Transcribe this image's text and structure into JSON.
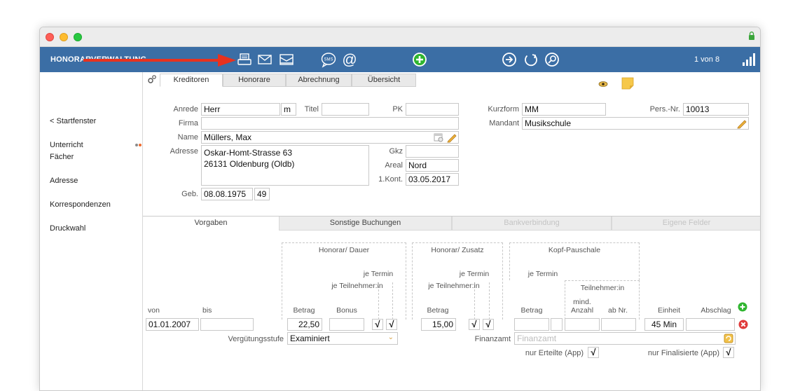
{
  "app": {
    "title": "HONORARVERWALTUNG",
    "record_counter": "1 von 8"
  },
  "toolbar": {
    "icons": [
      "printer-icon",
      "envelope-icon",
      "letter-icon",
      "sms-icon",
      "at-icon",
      "add-icon",
      "forward-icon",
      "refresh-icon",
      "search-icon",
      "signal-icon"
    ]
  },
  "sidebar": {
    "items": [
      {
        "label": "< Startfenster"
      },
      {
        "label": "Unterricht"
      },
      {
        "label": "Fächer"
      },
      {
        "label": "Adresse"
      },
      {
        "label": "Korrespondenzen"
      },
      {
        "label": "Druckwahl"
      }
    ]
  },
  "tabs": {
    "main": [
      "Kreditoren",
      "Honorare",
      "Abrechnung",
      "Übersicht"
    ],
    "active": "Kreditoren"
  },
  "form": {
    "anrede_label": "Anrede",
    "anrede": "Herr",
    "gender": "m",
    "titel_label": "Titel",
    "titel": "",
    "pk_label": "PK",
    "pk": "",
    "firma_label": "Firma",
    "firma": "",
    "name_label": "Name",
    "name": "Müllers, Max",
    "adresse_label": "Adresse",
    "adresse_line1": "Oskar-Homt-Strasse 63",
    "adresse_line2": "26131 Oldenburg (Oldb)",
    "gkz_label": "Gkz",
    "gkz": "",
    "areal_label": "Areal",
    "areal": "Nord",
    "kont_label": "1.Kont.",
    "kont": "03.05.2017",
    "geb_label": "Geb.",
    "geb": "08.08.1975",
    "age": "49",
    "kurzform_label": "Kurzform",
    "kurzform": "MM",
    "persnr_label": "Pers.-Nr.",
    "persnr": "10013",
    "mandant_label": "Mandant",
    "mandant": "Musikschule"
  },
  "subtabs": {
    "items": [
      "Vorgaben",
      "Sonstige Buchungen",
      "Bankverbindung",
      "Eigene Felder"
    ],
    "active": "Vorgaben"
  },
  "vorgaben": {
    "group_honorar_dauer": "Honorar/ Dauer",
    "group_honorar_zusatz": "Honorar/ Zusatz",
    "group_kopf": "Kopf-Pauschale",
    "je_termin": "je Termin",
    "je_teilnehmer": "je Teilnehmer:in",
    "teilnehmer": "Teilnehmer:in",
    "col_von": "von",
    "col_bis": "bis",
    "col_betrag": "Betrag",
    "col_bonus": "Bonus",
    "col_mind": "mind.",
    "col_anzahl": "Anzahl",
    "col_abnr": "ab Nr.",
    "col_einheit": "Einheit",
    "col_abschlag": "Abschlag",
    "row": {
      "von": "01.01.2007",
      "bis": "",
      "betrag1": "22,50",
      "bonus": "",
      "check1": "√",
      "check2": "√",
      "betrag2": "15,00",
      "check3": "√",
      "check4": "√",
      "betrag3": "",
      "einheit": "45 Min",
      "abschlag": ""
    },
    "verguetung_label": "Vergütungsstufe",
    "verguetung": "Examiniert",
    "finanzamt_label": "Finanzamt",
    "finanzamt_placeholder": "Finanzamt",
    "nur_erteilte_label": "nur Erteilte (App)",
    "nur_erteilte": "√",
    "nur_finalisierte_label": "nur Finalisierte (App)",
    "nur_finalisierte": "√"
  },
  "colors": {
    "toolbar": "#3b6ea5",
    "arrow": "#e8321e",
    "add_green": "#2fb52f",
    "delete_red": "#e03a3a"
  }
}
